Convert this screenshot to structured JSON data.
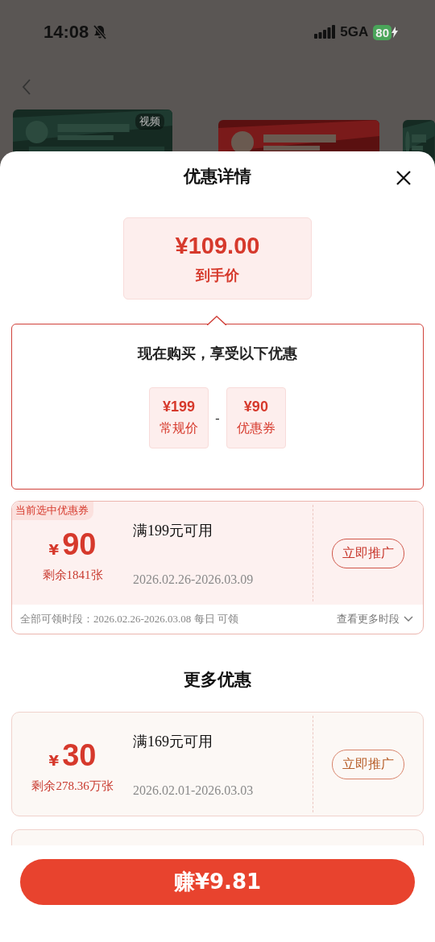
{
  "status_bar": {
    "time": "14:08",
    "network": "5GA",
    "battery": "80"
  },
  "background": {
    "cards": [
      {
        "kind": "picture",
        "badge": "视频"
      },
      {
        "kind": "picture"
      },
      {
        "kind": "picture"
      }
    ]
  },
  "sheet": {
    "title": "优惠详情",
    "price": {
      "amount": "¥109.00",
      "label": "到手价"
    },
    "breakdown": {
      "title": "现在购买，享受以下优惠",
      "operator": "-",
      "items": [
        {
          "amount": "¥199",
          "label": "常规价"
        },
        {
          "amount": "¥90",
          "label": "优惠券"
        }
      ]
    },
    "current_coupon": {
      "selected": true,
      "tag": "当前选中优惠券",
      "symbol": "¥",
      "value": "90",
      "remaining": "剩余1841张",
      "condition": "满199元可用",
      "dates": "2026.02.26-2026.03.09",
      "button": "立即推广",
      "footer": {
        "periods": "全部可领时段：2026.02.26-2026.03.08 每日 可领",
        "more": "查看更多时段"
      }
    },
    "more_title": "更多优惠",
    "more_coupons": [
      {
        "selected": false,
        "symbol": "¥",
        "value": "30",
        "remaining": "剩余278.36万张",
        "condition": "满169元可用",
        "dates": "2026.02.01-2026.03.03",
        "button": "立即推广"
      }
    ],
    "earn_button": "赚¥9.81"
  }
}
